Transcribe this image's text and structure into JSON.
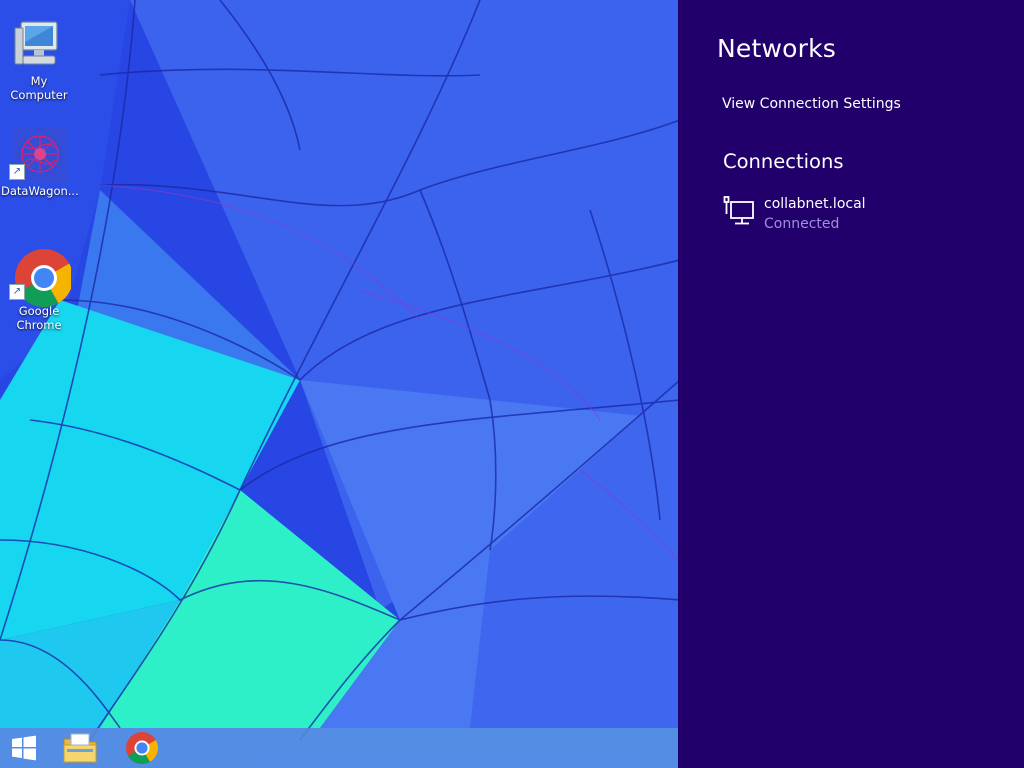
{
  "desktop": {
    "icons": [
      {
        "label": "My Computer",
        "icon": "computer-icon"
      },
      {
        "label": "DataWagon...",
        "icon": "datawagon-icon",
        "shortcut": true
      },
      {
        "label": "Google Chrome",
        "icon": "chrome-icon",
        "shortcut": true
      }
    ]
  },
  "taskbar": {
    "items": [
      {
        "icon": "windows-start-icon"
      },
      {
        "icon": "file-explorer-icon"
      },
      {
        "icon": "chrome-icon"
      }
    ],
    "color": "#78c8e6"
  },
  "charm": {
    "title": "Networks",
    "view_settings_link": "View Connection Settings",
    "connections_heading": "Connections",
    "connections": [
      {
        "name": "collabnet.local",
        "status": "Connected",
        "icon": "ethernet-icon"
      }
    ],
    "background": "#21006b",
    "status_color": "#9f8fdc"
  }
}
